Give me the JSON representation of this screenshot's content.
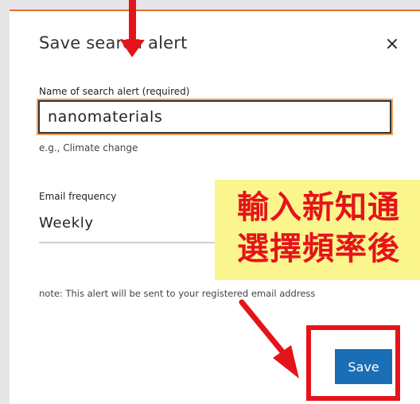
{
  "modal": {
    "title": "Save search alert",
    "close_label": "×"
  },
  "name_field": {
    "label": "Name of search alert (required)",
    "value": "nanomaterials",
    "hint": "e.g., Climate change"
  },
  "frequency": {
    "label": "Email frequency",
    "selected": "Weekly"
  },
  "note": "note: This alert will be sent to your registered email address",
  "save_label": "Save",
  "annotation": {
    "line1": "輸入新知通",
    "line2": "選擇頻率後",
    "color": "#e5141b",
    "background": "#fbf58e"
  },
  "accent_color": "#1a6eb5"
}
